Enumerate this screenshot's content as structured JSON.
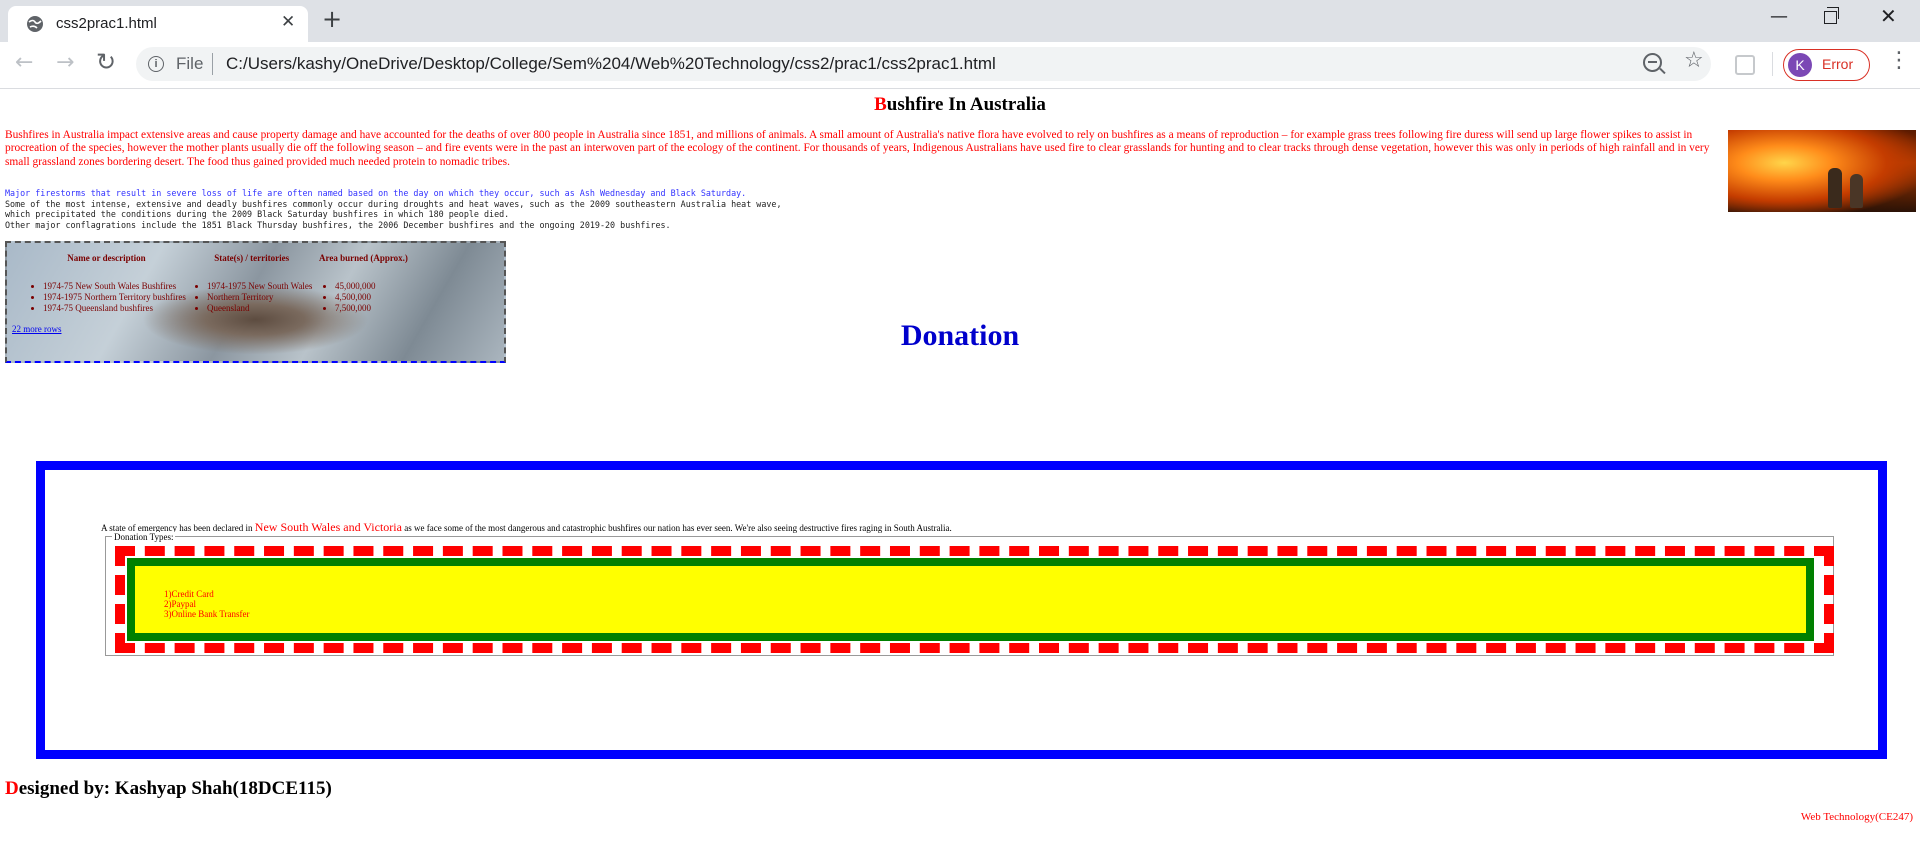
{
  "browser": {
    "tab_title": "css2prac1.html",
    "new_tab_symbol": "+",
    "close_symbol": "✕",
    "minimize_symbol": "—",
    "window_close_symbol": "✕",
    "omnibox_scheme_label": "File",
    "url": "C:/Users/kashy/OneDrive/Desktop/College/Sem%204/Web%20Technology/css2/prac1/css2prac1.html",
    "profile_initial": "K",
    "profile_status": "Error",
    "profile_color": "#7b48b5",
    "error_color": "#d93025",
    "icons": [
      "globe-icon",
      "back-icon",
      "forward-icon",
      "reload-icon",
      "info-icon",
      "zoom-out-icon",
      "star-icon",
      "extension-icon",
      "menu-icon"
    ]
  },
  "page": {
    "title_initial": "B",
    "title_rest": "ushfire In Australia",
    "intro": "Bushfires in Australia impact extensive areas and cause property damage and have accounted for the deaths of over 800 people in Australia since 1851, and millions of animals. A small amount of Australia's native flora have evolved to rely on bushfires as a means of reproduction – for example grass trees following fire duress will send up large flower spikes to assist in procreation of the species, however the mother plants usually die off the following season – and fire events were in the past an interwoven part of the ecology of the continent. For thousands of years, Indigenous Australians have used fire to clear grasslands for hunting and to clear tracks through dense vegetation, however this was only in periods of high rainfall and in very small grassland zones bordering desert. The food thus gained provided much needed protein to nomadic tribes.",
    "facts": [
      "Major firestorms that result in severe loss of life are often named based on the day on which they occur, such as Ash Wednesday and Black Saturday.",
      "Some of the most intense, extensive and deadly bushfires commonly occur during droughts and heat waves, such as the 2009 southeastern Australia heat wave,",
      "which precipitated the conditions during the 2009 Black Saturday bushfires in which 180 people died.",
      "Other major conflagrations include the 1851 Black Thursday bushfires, the 2006 December bushfires and the ongoing 2019-20 bushfires."
    ],
    "fires_table": {
      "headers": [
        "Name or description",
        "State(s) / territories",
        "Area burned (Approx.)"
      ],
      "names": [
        "1974-75 New South Wales Bushfires",
        "1974-1975 Northern Territory bushfires",
        "1974-75 Queensland bushfires"
      ],
      "states": [
        "1974-1975 New South Wales",
        "Northern Territory",
        "Queensland"
      ],
      "areas": [
        "45,000,000",
        "4,500,000",
        "7,500,000"
      ],
      "more_link": "22 more rows"
    },
    "donation": {
      "heading": "Donation",
      "emergency_before": "A state of emergency has been declared in ",
      "emergency_highlight": "New South Wales and Victoria",
      "emergency_after": " as we face some of the most dangerous and catastrophic bushfires our nation has ever seen. We're also seeing destructive fires raging in South Australia.",
      "legend": "Donation Types:",
      "types": [
        "1)Credit Card",
        "2)Paypal",
        "3)Online Bank Transfer"
      ]
    },
    "footer": {
      "designer_initial": "D",
      "designer_rest": "esigned by: Kashyap Shah(18DCE115)",
      "course": "Web Technology(CE247)"
    }
  }
}
